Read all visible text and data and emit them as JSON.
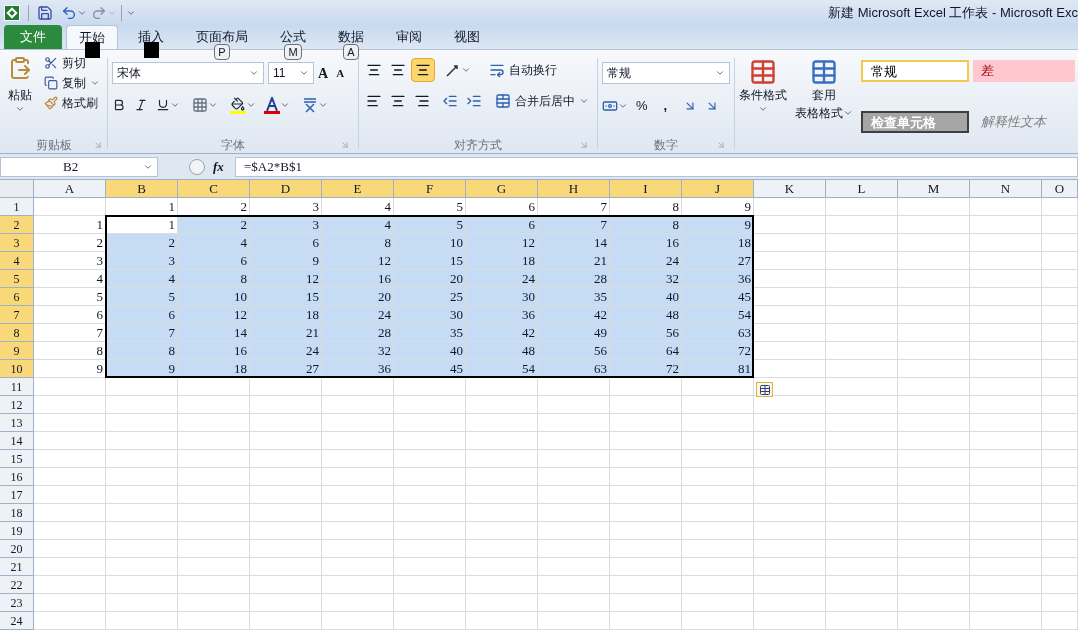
{
  "window": {
    "title": "新建 Microsoft Excel 工作表 - Microsoft Exc"
  },
  "ribbon_tabs": [
    {
      "label": "文件",
      "kind": "file",
      "selected": false
    },
    {
      "label": "开始",
      "kind": "tab",
      "selected": true,
      "key_tip_hidden": true
    },
    {
      "label": "插入",
      "kind": "tab",
      "selected": false,
      "key_tip_hidden": true
    },
    {
      "label": "页面布局",
      "kind": "tab",
      "selected": false,
      "key_tip": "P"
    },
    {
      "label": "公式",
      "kind": "tab",
      "selected": false,
      "key_tip": "M"
    },
    {
      "label": "数据",
      "kind": "tab",
      "selected": false,
      "key_tip": "A"
    },
    {
      "label": "审阅",
      "kind": "tab",
      "selected": false
    },
    {
      "label": "视图",
      "kind": "tab",
      "selected": false
    }
  ],
  "clipboard": {
    "paste": "粘贴",
    "cut": "剪切",
    "copy": "复制",
    "format_painter": "格式刷",
    "group": "剪贴板"
  },
  "font": {
    "name": "宋体",
    "size": "11",
    "grow": "A",
    "shrink": "A",
    "group": "字体"
  },
  "alignment": {
    "wrap_text": "自动换行",
    "merge_center": "合并后居中",
    "group": "对齐方式",
    "bottom_align_on": true
  },
  "number": {
    "format": "常规",
    "percent": "%",
    "comma": ",",
    "group": "数字"
  },
  "styles": {
    "conditional_format": "条件格式",
    "table_format": [
      "套用",
      "表格格式"
    ],
    "cell_styles": [
      {
        "label": "常规",
        "kind": "normal"
      },
      {
        "label": "差",
        "kind": "bad"
      },
      {
        "label": "检查单元格",
        "kind": "check"
      },
      {
        "label": "解释性文本",
        "kind": "explanatory"
      }
    ]
  },
  "formula_bar": {
    "name_box": "B2",
    "fx": "fx",
    "formula": "=$A2*B$1"
  },
  "sheet": {
    "columns": [
      {
        "label": "A",
        "selected": false
      },
      {
        "label": "B",
        "selected": true
      },
      {
        "label": "C",
        "selected": true
      },
      {
        "label": "D",
        "selected": true
      },
      {
        "label": "E",
        "selected": true
      },
      {
        "label": "F",
        "selected": true
      },
      {
        "label": "G",
        "selected": true
      },
      {
        "label": "H",
        "selected": true
      },
      {
        "label": "I",
        "selected": true
      },
      {
        "label": "J",
        "selected": true
      },
      {
        "label": "K",
        "selected": false
      },
      {
        "label": "L",
        "selected": false
      },
      {
        "label": "M",
        "selected": false
      },
      {
        "label": "N",
        "selected": false
      },
      {
        "label": "O",
        "selected": false
      }
    ],
    "rows": [
      {
        "header": "1",
        "selected": false,
        "cells": [
          null,
          "1",
          "2",
          "3",
          "4",
          "5",
          "6",
          "7",
          "8",
          "9"
        ]
      },
      {
        "header": "2",
        "selected": true,
        "cells": [
          "1",
          "1",
          "2",
          "3",
          "4",
          "5",
          "6",
          "7",
          "8",
          "9"
        ]
      },
      {
        "header": "3",
        "selected": true,
        "cells": [
          "2",
          "2",
          "4",
          "6",
          "8",
          "10",
          "12",
          "14",
          "16",
          "18"
        ]
      },
      {
        "header": "4",
        "selected": true,
        "cells": [
          "3",
          "3",
          "6",
          "9",
          "12",
          "15",
          "18",
          "21",
          "24",
          "27"
        ]
      },
      {
        "header": "5",
        "selected": true,
        "cells": [
          "4",
          "4",
          "8",
          "12",
          "16",
          "20",
          "24",
          "28",
          "32",
          "36"
        ]
      },
      {
        "header": "6",
        "selected": true,
        "cells": [
          "5",
          "5",
          "10",
          "15",
          "20",
          "25",
          "30",
          "35",
          "40",
          "45"
        ]
      },
      {
        "header": "7",
        "selected": true,
        "cells": [
          "6",
          "6",
          "12",
          "18",
          "24",
          "30",
          "36",
          "42",
          "48",
          "54"
        ]
      },
      {
        "header": "8",
        "selected": true,
        "cells": [
          "7",
          "7",
          "14",
          "21",
          "28",
          "35",
          "42",
          "49",
          "56",
          "63"
        ]
      },
      {
        "header": "9",
        "selected": true,
        "cells": [
          "8",
          "8",
          "16",
          "24",
          "32",
          "40",
          "48",
          "56",
          "64",
          "72"
        ]
      },
      {
        "header": "10",
        "selected": true,
        "cells": [
          "9",
          "9",
          "18",
          "27",
          "36",
          "45",
          "54",
          "63",
          "72",
          "81"
        ]
      },
      {
        "header": "11",
        "selected": false
      },
      {
        "header": "12",
        "selected": false
      },
      {
        "header": "13",
        "selected": false
      },
      {
        "header": "14",
        "selected": false
      },
      {
        "header": "15",
        "selected": false
      },
      {
        "header": "16",
        "selected": false
      },
      {
        "header": "17",
        "selected": false
      },
      {
        "header": "18",
        "selected": false
      },
      {
        "header": "19",
        "selected": false
      },
      {
        "header": "20",
        "selected": false
      },
      {
        "header": "21",
        "selected": false
      },
      {
        "header": "22",
        "selected": false
      },
      {
        "header": "23",
        "selected": false
      },
      {
        "header": "24",
        "selected": false
      }
    ],
    "paste_options": true
  }
}
